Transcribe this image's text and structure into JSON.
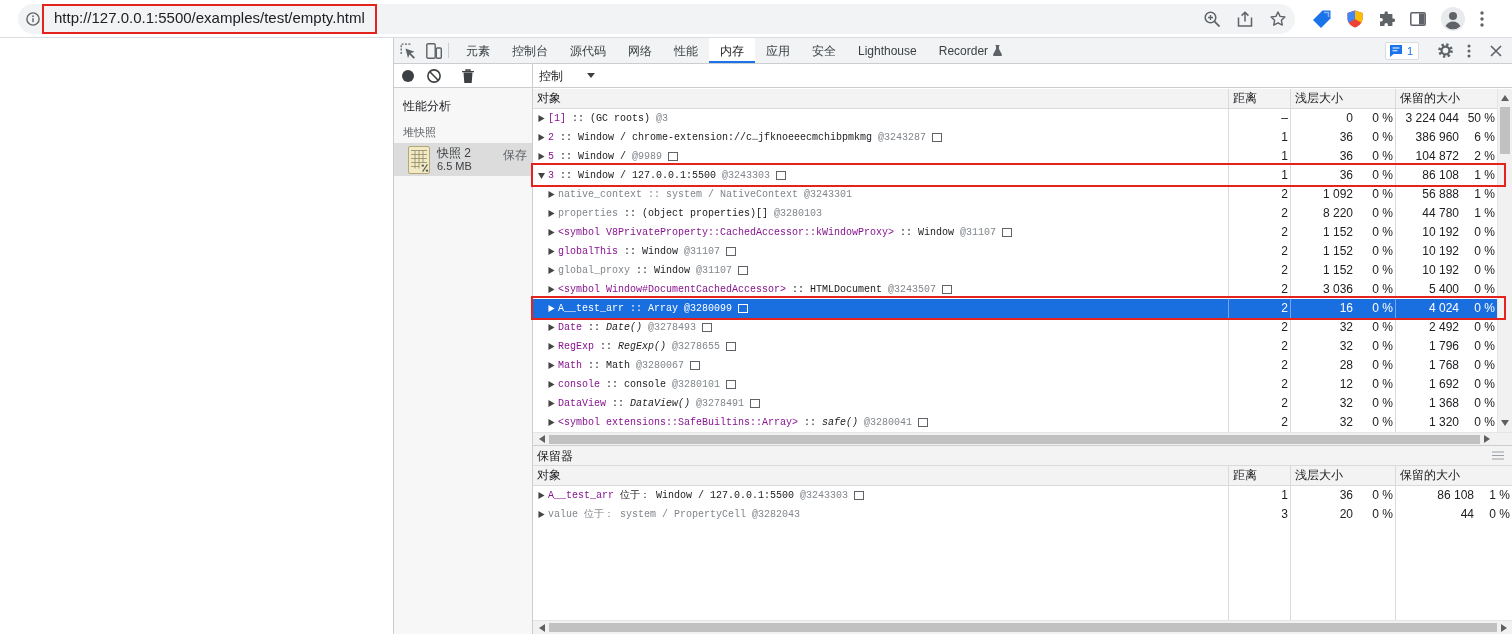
{
  "browser": {
    "url": "http://127.0.0.1:5500/examples/test/empty.html",
    "url_outlined": true
  },
  "devtools": {
    "tabs": [
      {
        "label": "元素",
        "selected": false,
        "experimental": false
      },
      {
        "label": "控制台",
        "selected": false,
        "experimental": false
      },
      {
        "label": "源代码",
        "selected": false,
        "experimental": false
      },
      {
        "label": "网络",
        "selected": false,
        "experimental": false
      },
      {
        "label": "性能",
        "selected": false,
        "experimental": false
      },
      {
        "label": "内存",
        "selected": true,
        "experimental": false
      },
      {
        "label": "应用",
        "selected": false,
        "experimental": false
      },
      {
        "label": "安全",
        "selected": false,
        "experimental": false
      },
      {
        "label": "Lighthouse",
        "selected": false,
        "experimental": false
      },
      {
        "label": "Recorder",
        "selected": false,
        "experimental": true
      }
    ],
    "issues_count": "1",
    "view": "控制",
    "sidebar": {
      "title": "性能分析",
      "group": "堆快照",
      "snapshots": [
        {
          "name": "快照 2",
          "size": "6.5 MB",
          "action": "保存",
          "selected": true
        }
      ]
    },
    "table": {
      "columns": [
        "对象",
        "距离",
        "浅层大小",
        "保留的大小"
      ],
      "rows": [
        {
          "kind": "property",
          "name": "[1]",
          "detail": ":: (GC roots)",
          "id": "@3",
          "reveal": false,
          "expanded": false,
          "selected": false,
          "outlined": false,
          "distance": "–",
          "shallow": "0",
          "shallow_pct": "0 %",
          "retained": "3 224 044",
          "retained_pct": "50 %"
        },
        {
          "kind": "property",
          "name": "2",
          "detail": ":: Window / chrome-extension://c…jfknoeeecmchibpmkmg",
          "id": "@3243287",
          "reveal": true,
          "expanded": false,
          "selected": false,
          "outlined": false,
          "distance": "1",
          "shallow": "36",
          "shallow_pct": "0 %",
          "retained": "386 960",
          "retained_pct": "6 %"
        },
        {
          "kind": "property",
          "name": "5",
          "detail": ":: Window /",
          "id": "@9989",
          "reveal": true,
          "expanded": false,
          "selected": false,
          "outlined": false,
          "distance": "1",
          "shallow": "36",
          "shallow_pct": "0 %",
          "retained": "104 872",
          "retained_pct": "2 %"
        },
        {
          "kind": "property",
          "name": "3",
          "detail": ":: Window / 127.0.0.1:5500",
          "id": "@3243303",
          "reveal": true,
          "expanded": true,
          "selected": false,
          "outlined": true,
          "distance": "1",
          "shallow": "36",
          "shallow_pct": "0 %",
          "retained": "86 108",
          "retained_pct": "1 %",
          "children": [
            {
              "kind": "system",
              "name": "native_context",
              "detail": ":: system / NativeContext",
              "id": "@3243301",
              "reveal": false,
              "expanded": false,
              "selected": false,
              "outlined": false,
              "distance": "2",
              "shallow": "1 092",
              "shallow_pct": "0 %",
              "retained": "56 888",
              "retained_pct": "1 %"
            },
            {
              "kind": "internal",
              "name": "properties",
              "detail": ":: (object properties)[]",
              "id": "@3280103",
              "reveal": false,
              "expanded": false,
              "selected": false,
              "outlined": false,
              "distance": "2",
              "shallow": "8 220",
              "shallow_pct": "0 %",
              "retained": "44 780",
              "retained_pct": "1 %"
            },
            {
              "kind": "property",
              "name": "<symbol V8PrivateProperty::CachedAccessor::kWindowProxy>",
              "detail": ":: Window",
              "id": "@31107",
              "reveal": true,
              "expanded": false,
              "selected": false,
              "outlined": false,
              "distance": "2",
              "shallow": "1 152",
              "shallow_pct": "0 %",
              "retained": "10 192",
              "retained_pct": "0 %"
            },
            {
              "kind": "property",
              "name": "globalThis",
              "detail": ":: Window",
              "id": "@31107",
              "reveal": true,
              "expanded": false,
              "selected": false,
              "outlined": false,
              "distance": "2",
              "shallow": "1 152",
              "shallow_pct": "0 %",
              "retained": "10 192",
              "retained_pct": "0 %"
            },
            {
              "kind": "internal",
              "name": "global_proxy",
              "detail": ":: Window",
              "id": "@31107",
              "reveal": true,
              "expanded": false,
              "selected": false,
              "outlined": false,
              "distance": "2",
              "shallow": "1 152",
              "shallow_pct": "0 %",
              "retained": "10 192",
              "retained_pct": "0 %"
            },
            {
              "kind": "property",
              "name": "<symbol Window#DocumentCachedAccessor>",
              "detail": ":: HTMLDocument",
              "id": "@3243507",
              "reveal": true,
              "expanded": false,
              "selected": false,
              "outlined": false,
              "distance": "2",
              "shallow": "3 036",
              "shallow_pct": "0 %",
              "retained": "5 400",
              "retained_pct": "0 %"
            },
            {
              "kind": "property",
              "name": "A__test_arr",
              "detail": ":: Array",
              "id": "@3280099",
              "reveal": true,
              "expanded": false,
              "selected": true,
              "outlined": true,
              "distance": "2",
              "shallow": "16",
              "shallow_pct": "0 %",
              "retained": "4 024",
              "retained_pct": "0 %"
            },
            {
              "kind": "property",
              "name": "Date",
              "detail": ":: *Date()*",
              "id": "@3278493",
              "reveal": true,
              "expanded": false,
              "selected": false,
              "outlined": false,
              "distance": "2",
              "shallow": "32",
              "shallow_pct": "0 %",
              "retained": "2 492",
              "retained_pct": "0 %"
            },
            {
              "kind": "property",
              "name": "RegExp",
              "detail": ":: *RegExp()*",
              "id": "@3278655",
              "reveal": true,
              "expanded": false,
              "selected": false,
              "outlined": false,
              "distance": "2",
              "shallow": "32",
              "shallow_pct": "0 %",
              "retained": "1 796",
              "retained_pct": "0 %"
            },
            {
              "kind": "property",
              "name": "Math",
              "detail": ":: Math",
              "id": "@3280067",
              "reveal": true,
              "expanded": false,
              "selected": false,
              "outlined": false,
              "distance": "2",
              "shallow": "28",
              "shallow_pct": "0 %",
              "retained": "1 768",
              "retained_pct": "0 %"
            },
            {
              "kind": "property",
              "name": "console",
              "detail": ":: console",
              "id": "@3280101",
              "reveal": true,
              "expanded": false,
              "selected": false,
              "outlined": false,
              "distance": "2",
              "shallow": "12",
              "shallow_pct": "0 %",
              "retained": "1 692",
              "retained_pct": "0 %"
            },
            {
              "kind": "property",
              "name": "DataView",
              "detail": ":: *DataView()*",
              "id": "@3278491",
              "reveal": true,
              "expanded": false,
              "selected": false,
              "outlined": false,
              "distance": "2",
              "shallow": "32",
              "shallow_pct": "0 %",
              "retained": "1 368",
              "retained_pct": "0 %"
            },
            {
              "kind": "property",
              "name": "<symbol extensions::SafeBuiltins::Array>",
              "detail": ":: *safe()*",
              "id": "@3280041",
              "reveal": true,
              "expanded": false,
              "selected": false,
              "outlined": false,
              "distance": "2",
              "shallow": "32",
              "shallow_pct": "0 %",
              "retained": "1 320",
              "retained_pct": "0 %"
            }
          ]
        }
      ]
    },
    "retainers": {
      "title": "保留器",
      "columns": [
        "对象",
        "距离",
        "浅层大小",
        "保留的大小"
      ],
      "rows": [
        {
          "kind": "property",
          "name": "A__test_arr",
          "detail": "位于： Window / 127.0.0.1:5500",
          "id": "@3243303",
          "reveal": true,
          "expanded": false,
          "selected": false,
          "distance": "1",
          "shallow": "36",
          "shallow_pct": "0 %",
          "retained": "86 108",
          "retained_pct": "1 %"
        },
        {
          "kind": "system",
          "name": "value",
          "detail": "位于： system / PropertyCell",
          "id": "@3282043",
          "reveal": false,
          "expanded": false,
          "selected": false,
          "distance": "3",
          "shallow": "20",
          "shallow_pct": "0 %",
          "retained": "44",
          "retained_pct": "0 %"
        }
      ]
    }
  }
}
